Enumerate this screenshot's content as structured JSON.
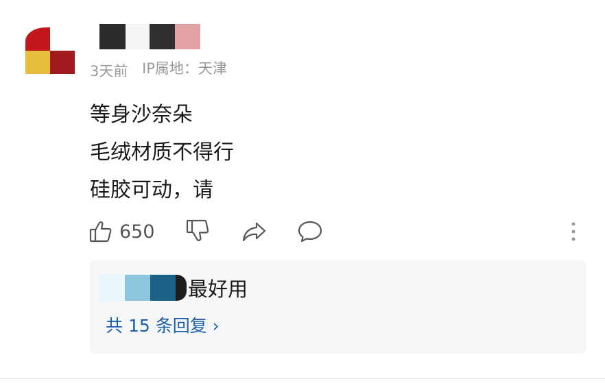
{
  "comment": {
    "time": "3天前",
    "ip_location": "IP属地：天津",
    "lines": [
      "等身沙奈朵",
      "毛绒材质不得行",
      "硅胶可动，请"
    ],
    "like_count": "650"
  },
  "actions": {
    "like_icon": "thumbs-up-icon",
    "dislike_icon": "thumbs-down-icon",
    "share_icon": "share-icon",
    "comment_icon": "comment-bubble-icon",
    "more_icon": "more-vertical-icon"
  },
  "reply": {
    "text": "最好用",
    "more_replies_label": "共 15 条回复 ›"
  },
  "colors": {
    "link_blue": "#1d5fa8",
    "reply_bg": "#f5f6f8",
    "meta_gray": "#9a9a9a"
  }
}
